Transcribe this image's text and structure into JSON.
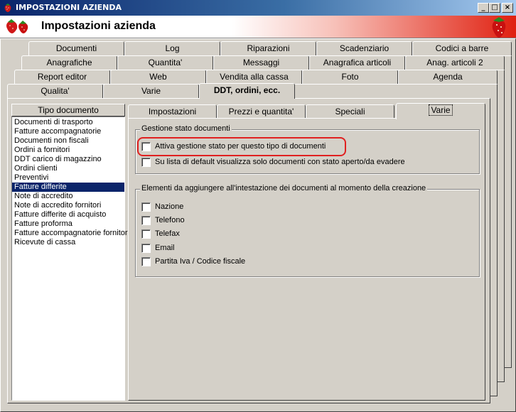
{
  "window": {
    "title": "IMPOSTAZIONI AZIENDA",
    "header_title": "Impostazioni azienda",
    "minimize": "_",
    "maximize": "□",
    "close": "×"
  },
  "tabs": {
    "row1": [
      "Documenti",
      "Log",
      "Riparazioni",
      "Scadenziario",
      "Codici a barre"
    ],
    "row2": [
      "Anagrafiche",
      "Quantita'",
      "Messaggi",
      "Anagrafica articoli",
      "Anag. articoli 2"
    ],
    "row3": [
      "Report editor",
      "Web",
      "Vendita alla cassa",
      "Foto",
      "Agenda"
    ],
    "row4": [
      "Qualita'",
      "Varie",
      "DDT, ordini, ecc."
    ]
  },
  "active_tab": "DDT, ordini, ecc.",
  "doc_list": {
    "header": "Tipo documento",
    "items": [
      "Documenti di trasporto",
      "Fatture accompagnatorie",
      "Documenti non fiscali",
      "Ordini a fornitori",
      "DDT carico di magazzino",
      "Ordini clienti",
      "Preventivi",
      "Fatture differite",
      "Note di accredito",
      "Note di accredito fornitori",
      "Fatture differite di acquisto",
      "Fatture proforma",
      "Fatture accompagnatorie fornitori",
      "Ricevute di cassa"
    ],
    "selected": "Fatture differite"
  },
  "inner_tabs": [
    "Impostazioni",
    "Prezzi e quantita'",
    "Speciali",
    "Varie"
  ],
  "inner_active_tab": "Varie",
  "group_stato": {
    "legend": "Gestione stato documenti",
    "checkboxes": [
      {
        "label": "Attiva gestione stato per questo tipo di documenti",
        "checked": false
      },
      {
        "label": "Su lista di default visualizza solo documenti con stato aperto/da evadere",
        "checked": false
      }
    ]
  },
  "group_intestazione": {
    "legend": "Elementi da aggiungere all'intestazione dei documenti al momento della creazione",
    "checkboxes": [
      {
        "label": "Nazione",
        "checked": false
      },
      {
        "label": "Telefono",
        "checked": false
      },
      {
        "label": "Telefax",
        "checked": false
      },
      {
        "label": "Email",
        "checked": false
      },
      {
        "label": "Partita Iva / Codice fiscale",
        "checked": false
      }
    ]
  },
  "colors": {
    "titlebar": "#0a246a",
    "selection": "#0a246a",
    "highlight": "#e02020",
    "face": "#d4d0c8"
  },
  "icons": {
    "app": "strawberry-icon",
    "header_logo": "strawberries-icon",
    "header_logo_right": "strawberry-icon"
  }
}
